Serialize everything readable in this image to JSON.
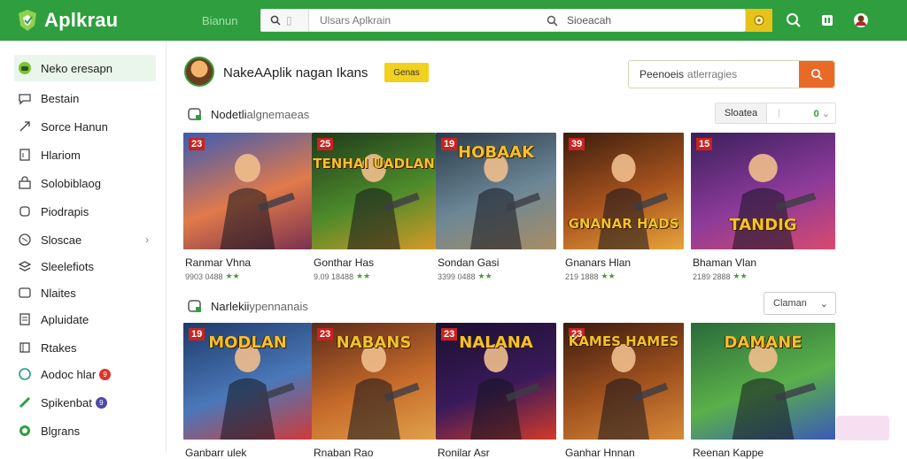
{
  "app": {
    "name": "Aplkrau"
  },
  "topbar": {
    "label": "Bianun",
    "search_placeholder": "Ulsars Aplkrain",
    "search_right_label": "Sioeacah",
    "icons": [
      "search-icon",
      "coin-icon",
      "magnifier-icon",
      "grid-icon",
      "profile-icon"
    ]
  },
  "sidebar": {
    "items": [
      {
        "label": "Neko eresapn",
        "icon": "gamepad-icon",
        "active": true
      },
      {
        "label": "Bestain",
        "icon": "chat-icon"
      },
      {
        "label": "Sorce Hanun",
        "icon": "cursor-icon"
      },
      {
        "label": "Hlariom",
        "icon": "clipboard-icon"
      },
      {
        "label": "Solobiblaog",
        "icon": "bag-icon"
      },
      {
        "label": "Piodrapis",
        "icon": "chip-icon"
      },
      {
        "label": "Sloscae",
        "icon": "tag-icon"
      },
      {
        "label": "Sleelefiots",
        "icon": "layers-icon"
      },
      {
        "label": "Nlaites",
        "icon": "card-icon"
      },
      {
        "label": "Apluidate",
        "icon": "pages-icon"
      },
      {
        "label": "Rtakes",
        "icon": "square-icon"
      },
      {
        "label": "Aodoc hlar",
        "icon": "circle-icon",
        "badge": "9",
        "badge_color": "#d9342b"
      },
      {
        "label": "Spikenbat",
        "icon": "pencil-icon",
        "badge": "9",
        "badge_color": "#4b4aa8"
      },
      {
        "label": "Blgrans",
        "icon": "ring-icon"
      }
    ]
  },
  "header": {
    "title": "NakeAAplik  nagan  Ikans",
    "badge": "Genas",
    "search_label": "Peenoeis",
    "search_hint": "atlerragies"
  },
  "sections": [
    {
      "title": "Nodetli",
      "title_muted": "algnemaeas",
      "filter_label": "Sloatea",
      "filter_value": "0",
      "cards": [
        {
          "num": "23",
          "name": "Ranmar Vhna",
          "meta": "9903 0488",
          "art": "",
          "palette": [
            "#3b5bb5",
            "#e07a4a",
            "#7a3050"
          ]
        },
        {
          "num": "25",
          "name": "Gonthar Has",
          "meta": "9.09 18488",
          "art": "TENHAI UADLAN",
          "palette": [
            "#1f3a1c",
            "#4c8a2a",
            "#d39a27"
          ]
        },
        {
          "num": "19",
          "name": "Sondan Gasi",
          "meta": "3399 0488",
          "art": "HOBAAK",
          "palette": [
            "#2a3a4a",
            "#6c8796",
            "#a88d63"
          ]
        },
        {
          "num": "39",
          "name": "Gnanars Hlan",
          "meta": "219 1888",
          "art": "GNANAR HADS",
          "palette": [
            "#3b1d0e",
            "#a9541e",
            "#e8a43b"
          ]
        },
        {
          "num": "15",
          "name": "Bhaman Vlan",
          "meta": "2189 2888",
          "art": "TANDIG",
          "palette": [
            "#3a1f5a",
            "#8b3a9a",
            "#d84a6e"
          ]
        }
      ]
    },
    {
      "title": "Narlekii",
      "title_muted": "ypennanais",
      "dropdown_label": "Claman",
      "cards": [
        {
          "num": "19",
          "name": "Ganbarr ulek",
          "art": "MODLAN",
          "palette": [
            "#1e3a6a",
            "#4a78b8",
            "#d13a3a"
          ]
        },
        {
          "num": "23",
          "name": "Rnaban Rao",
          "art": "NABANS",
          "palette": [
            "#5a2a1a",
            "#c56a2a",
            "#e0a04a"
          ]
        },
        {
          "num": "23",
          "name": "Ronilar Asr",
          "art": "NALANA",
          "palette": [
            "#1a1030",
            "#3a1a5a",
            "#d23a2a"
          ]
        },
        {
          "num": "23",
          "name": "Ganhar Hnnan",
          "art": "KAMES HAMES",
          "palette": [
            "#3a1a10",
            "#a0521e",
            "#d88a3a"
          ]
        },
        {
          "num": "",
          "name": "Reenan Kappe",
          "art": "DAMANE",
          "palette": [
            "#2a6a3a",
            "#5ab04a",
            "#3a5ab8"
          ]
        }
      ]
    }
  ]
}
